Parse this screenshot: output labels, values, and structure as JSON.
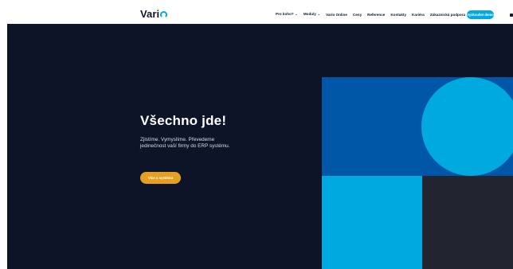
{
  "header": {
    "logo_text": "Vari",
    "nav_items": [
      {
        "label": "Pro koho?",
        "icon": "chevron-down-icon"
      },
      {
        "label": "Moduly",
        "icon": "chevron-down-icon"
      },
      {
        "label": "Vario Online"
      },
      {
        "label": "Ceny"
      },
      {
        "label": "Reference"
      },
      {
        "label": "Kontakty"
      },
      {
        "label": "Kariéra"
      },
      {
        "label": "Zákaznická podpora"
      }
    ],
    "cta_label": "Vyzkoušet demo"
  },
  "hero": {
    "headline": "Všechno jde!",
    "subtext": "Zjistíme. Vymyslíme. Převedeme jedinečnost vaší firmy do ERP systému.",
    "button_label": "Více o systému"
  },
  "colors": {
    "hero_bg": "#0d1428",
    "accent_blue": "#00a9e0",
    "deep_blue": "#0057a8",
    "button_orange": "#e6a021"
  }
}
